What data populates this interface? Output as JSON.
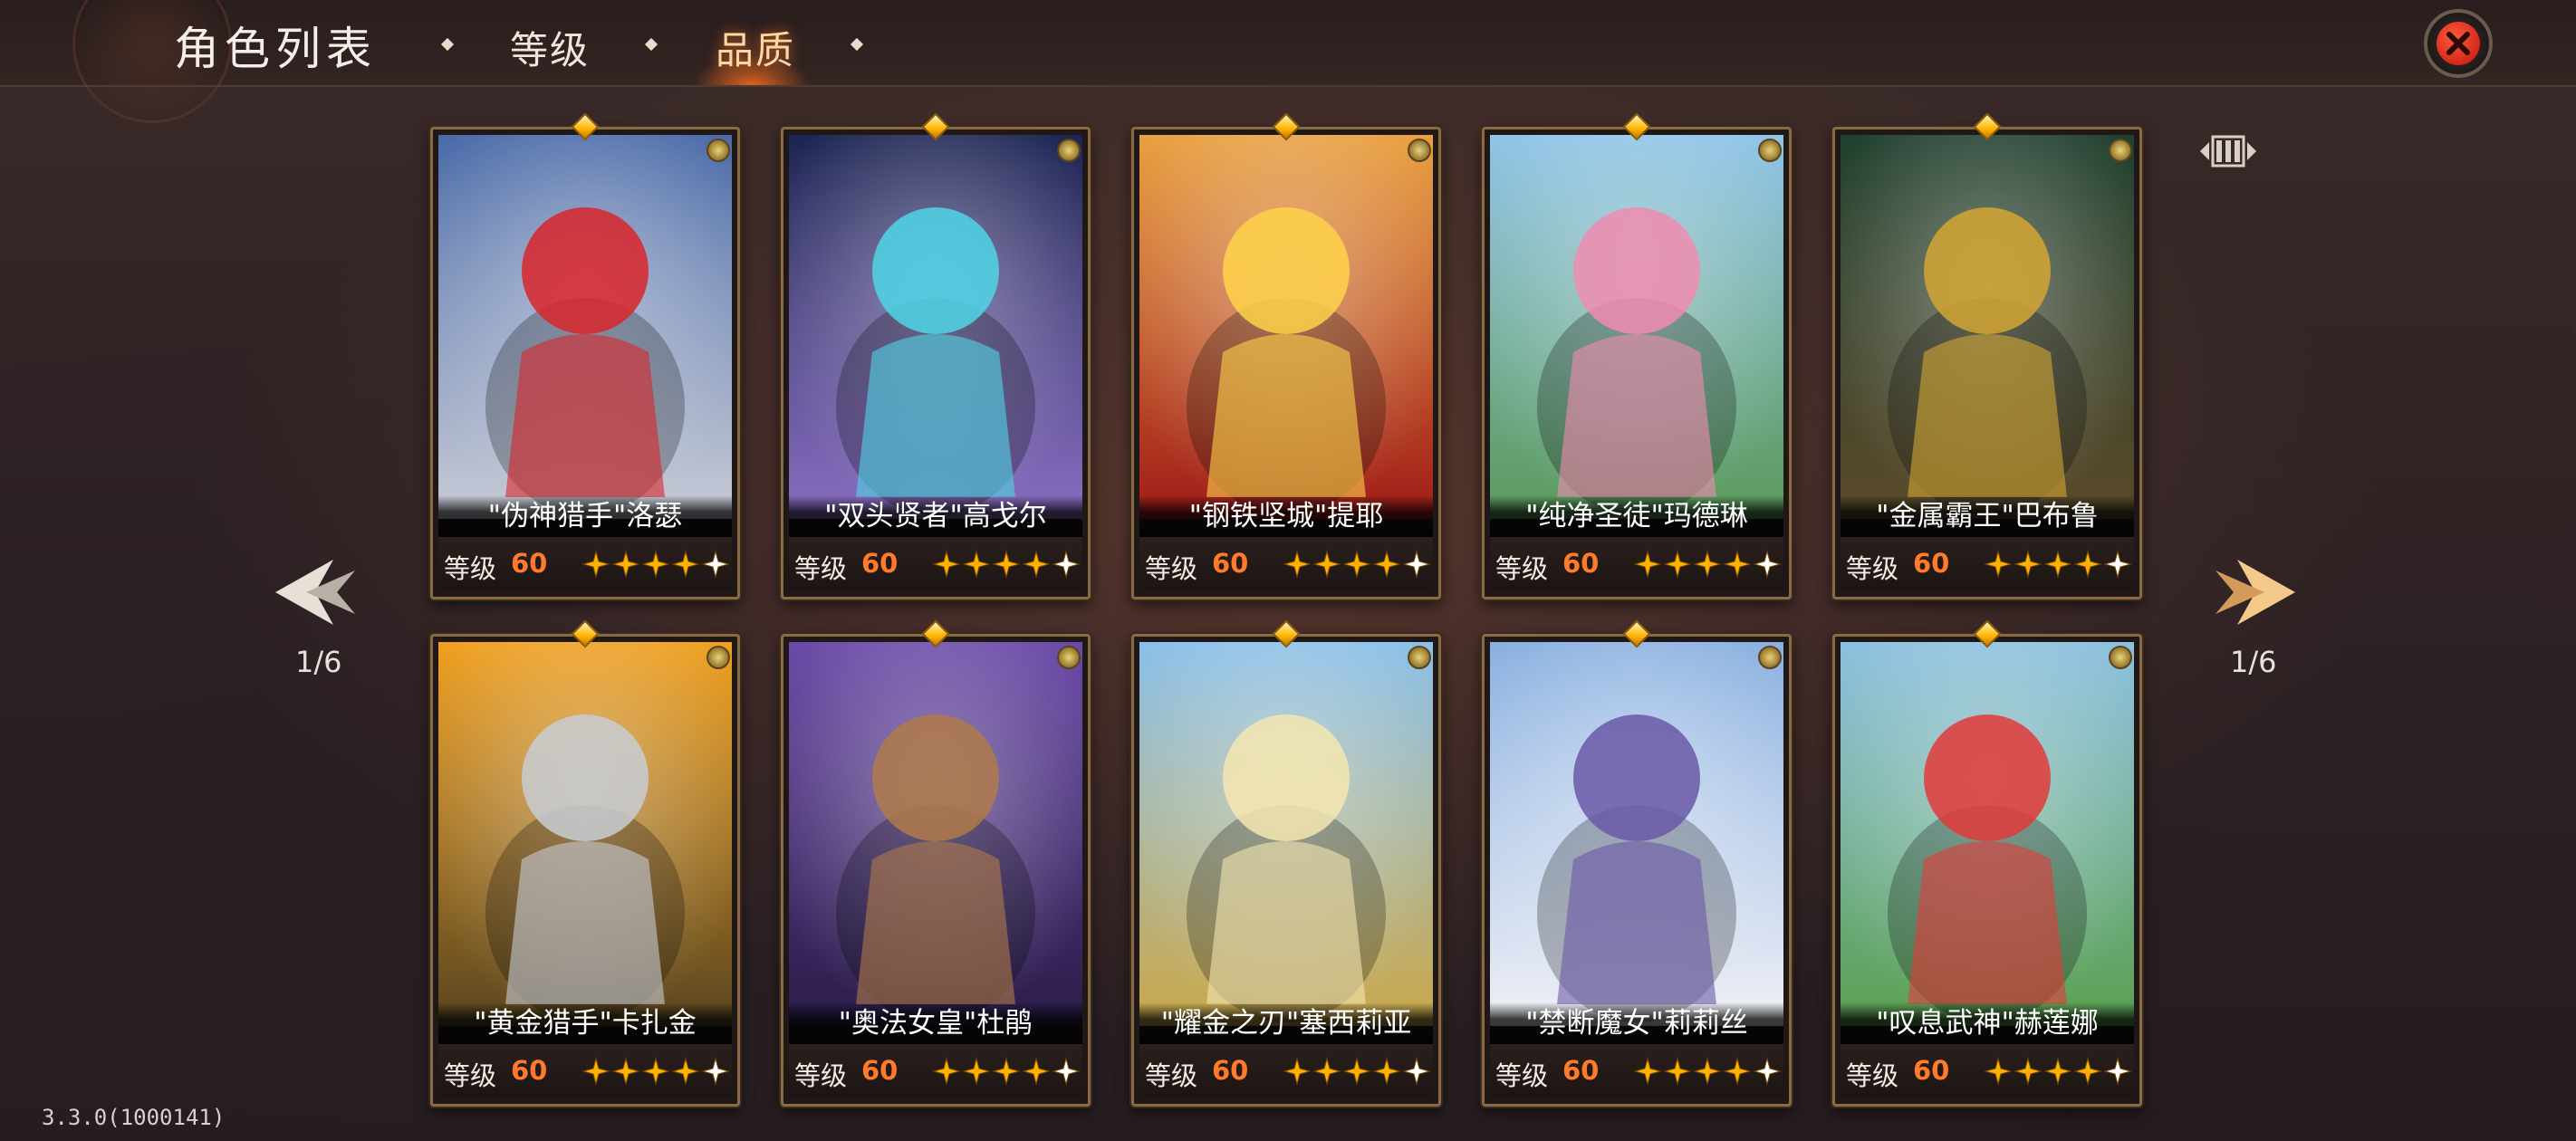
{
  "header": {
    "title": "角色列表",
    "tabs": [
      {
        "label": "等级",
        "active": false
      },
      {
        "label": "品质",
        "active": true
      }
    ]
  },
  "navigation": {
    "left_page": "1/6",
    "right_page": "1/6"
  },
  "level_label": "等级",
  "cards": [
    {
      "name": "\"伪神猎手\"洛瑟",
      "level": "60",
      "stars": 5,
      "theme": [
        "#4a6aa8",
        "#c9ccd6"
      ],
      "accent": "#d9262a"
    },
    {
      "name": "\"双头贤者\"高戈尔",
      "level": "60",
      "stars": 5,
      "theme": [
        "#1c2452",
        "#8a6fc2"
      ],
      "accent": "#4fd6e8"
    },
    {
      "name": "\"钢铁坚城\"提耶",
      "level": "60",
      "stars": 5,
      "theme": [
        "#e9a040",
        "#a01c18"
      ],
      "accent": "#ffd24a"
    },
    {
      "name": "\"纯净圣徒\"玛德琳",
      "level": "60",
      "stars": 5,
      "theme": [
        "#8fc4e8",
        "#5a9a5a"
      ],
      "accent": "#f08cb0"
    },
    {
      "name": "\"金属霸王\"巴布鲁",
      "level": "60",
      "stars": 5,
      "theme": [
        "#20402f",
        "#5a4a2a"
      ],
      "accent": "#d4a634"
    },
    {
      "name": "\"黄金猎手\"卡扎金",
      "level": "60",
      "stars": 5,
      "theme": [
        "#f0a020",
        "#5a4620"
      ],
      "accent": "#c8ccd4"
    },
    {
      "name": "\"奥法女皇\"杜鹃",
      "level": "60",
      "stars": 5,
      "theme": [
        "#6a4aa8",
        "#2a1c48"
      ],
      "accent": "#b07a4a"
    },
    {
      "name": "\"耀金之刃\"塞西莉亚",
      "level": "60",
      "stars": 5,
      "theme": [
        "#8ac0ea",
        "#caa84a"
      ],
      "accent": "#f4e6b0"
    },
    {
      "name": "\"禁断魔女\"莉莉丝",
      "level": "60",
      "stars": 5,
      "theme": [
        "#8ab0e0",
        "#f0f0f6"
      ],
      "accent": "#6a58a8"
    },
    {
      "name": "\"叹息武神\"赫莲娜",
      "level": "60",
      "stars": 5,
      "theme": [
        "#8cc0e0",
        "#5aa050"
      ],
      "accent": "#e23a3a"
    }
  ],
  "version": "3.3.0(1000141)"
}
